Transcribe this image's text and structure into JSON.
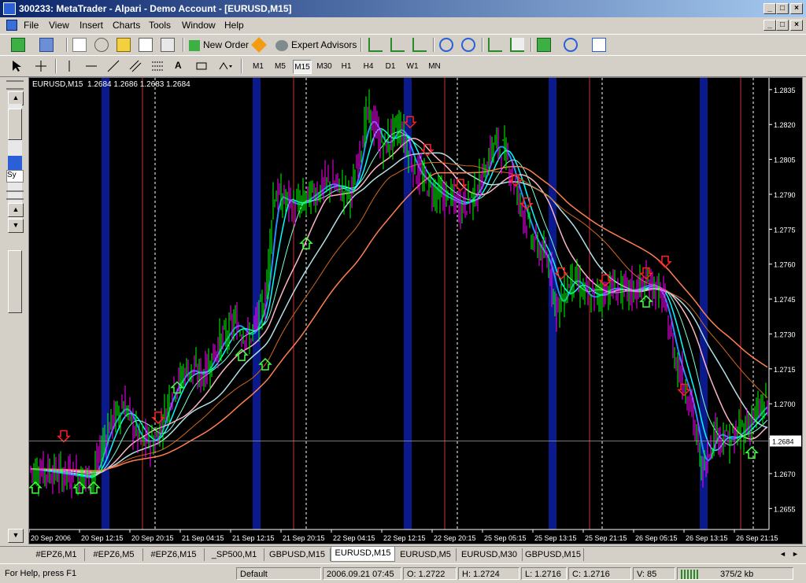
{
  "window": {
    "title": "300233: MetaTrader - Alpari - Demo Account - [EURUSD,M15]",
    "controls": [
      "_",
      "□",
      "×"
    ]
  },
  "menu": [
    "File",
    "View",
    "Insert",
    "Charts",
    "Tools",
    "Window",
    "Help"
  ],
  "toolbar": {
    "new_order": "New Order",
    "expert_advisors": "Expert Advisors",
    "timeframes": [
      "M1",
      "M5",
      "M15",
      "M30",
      "H1",
      "H4",
      "D1",
      "W1",
      "MN"
    ],
    "active_timeframe": "M15"
  },
  "left_panel": {
    "label": "Sy"
  },
  "chart": {
    "info": "EURUSD,M15  1.2684 1.2686 1.2683 1.2684",
    "current_price": "1.2684",
    "y_ticks": [
      "1.2835",
      "1.2820",
      "1.2805",
      "1.2790",
      "1.2775",
      "1.2760",
      "1.2745",
      "1.2730",
      "1.2715",
      "1.2700",
      "1.2685",
      "1.2670",
      "1.2655"
    ],
    "x_ticks": [
      "20 Sep 2006",
      "20 Sep 12:15",
      "20 Sep 20:15",
      "21 Sep 04:15",
      "21 Sep 12:15",
      "21 Sep 20:15",
      "22 Sep 04:15",
      "22 Sep 12:15",
      "22 Sep 20:15",
      "25 Sep 05:15",
      "25 Sep 13:15",
      "25 Sep 21:15",
      "26 Sep 05:15",
      "26 Sep 13:15",
      "26 Sep 21:15"
    ],
    "colors": {
      "background": "#000000",
      "bull": "#00ff00",
      "bear": "#ff00ff",
      "session": "#0a1a8c",
      "axis": "#ffffff"
    }
  },
  "tabs": [
    "#EPZ6,M1",
    "#EPZ6,M5",
    "#EPZ6,M15",
    "_SP500,M1",
    "GBPUSD,M15",
    "EURUSD,M15",
    "EURUSD,M5",
    "EURUSD,M30",
    "GBPUSD,M15"
  ],
  "active_tab": "EURUSD,M15",
  "status": {
    "help": "For Help, press F1",
    "profile": "Default",
    "time": "2006.09.21 07:45",
    "open": "O: 1.2722",
    "high": "H: 1.2724",
    "low": "L: 1.2716",
    "close": "C: 1.2716",
    "volume": "V: 85",
    "traffic": "375/2 kb"
  }
}
